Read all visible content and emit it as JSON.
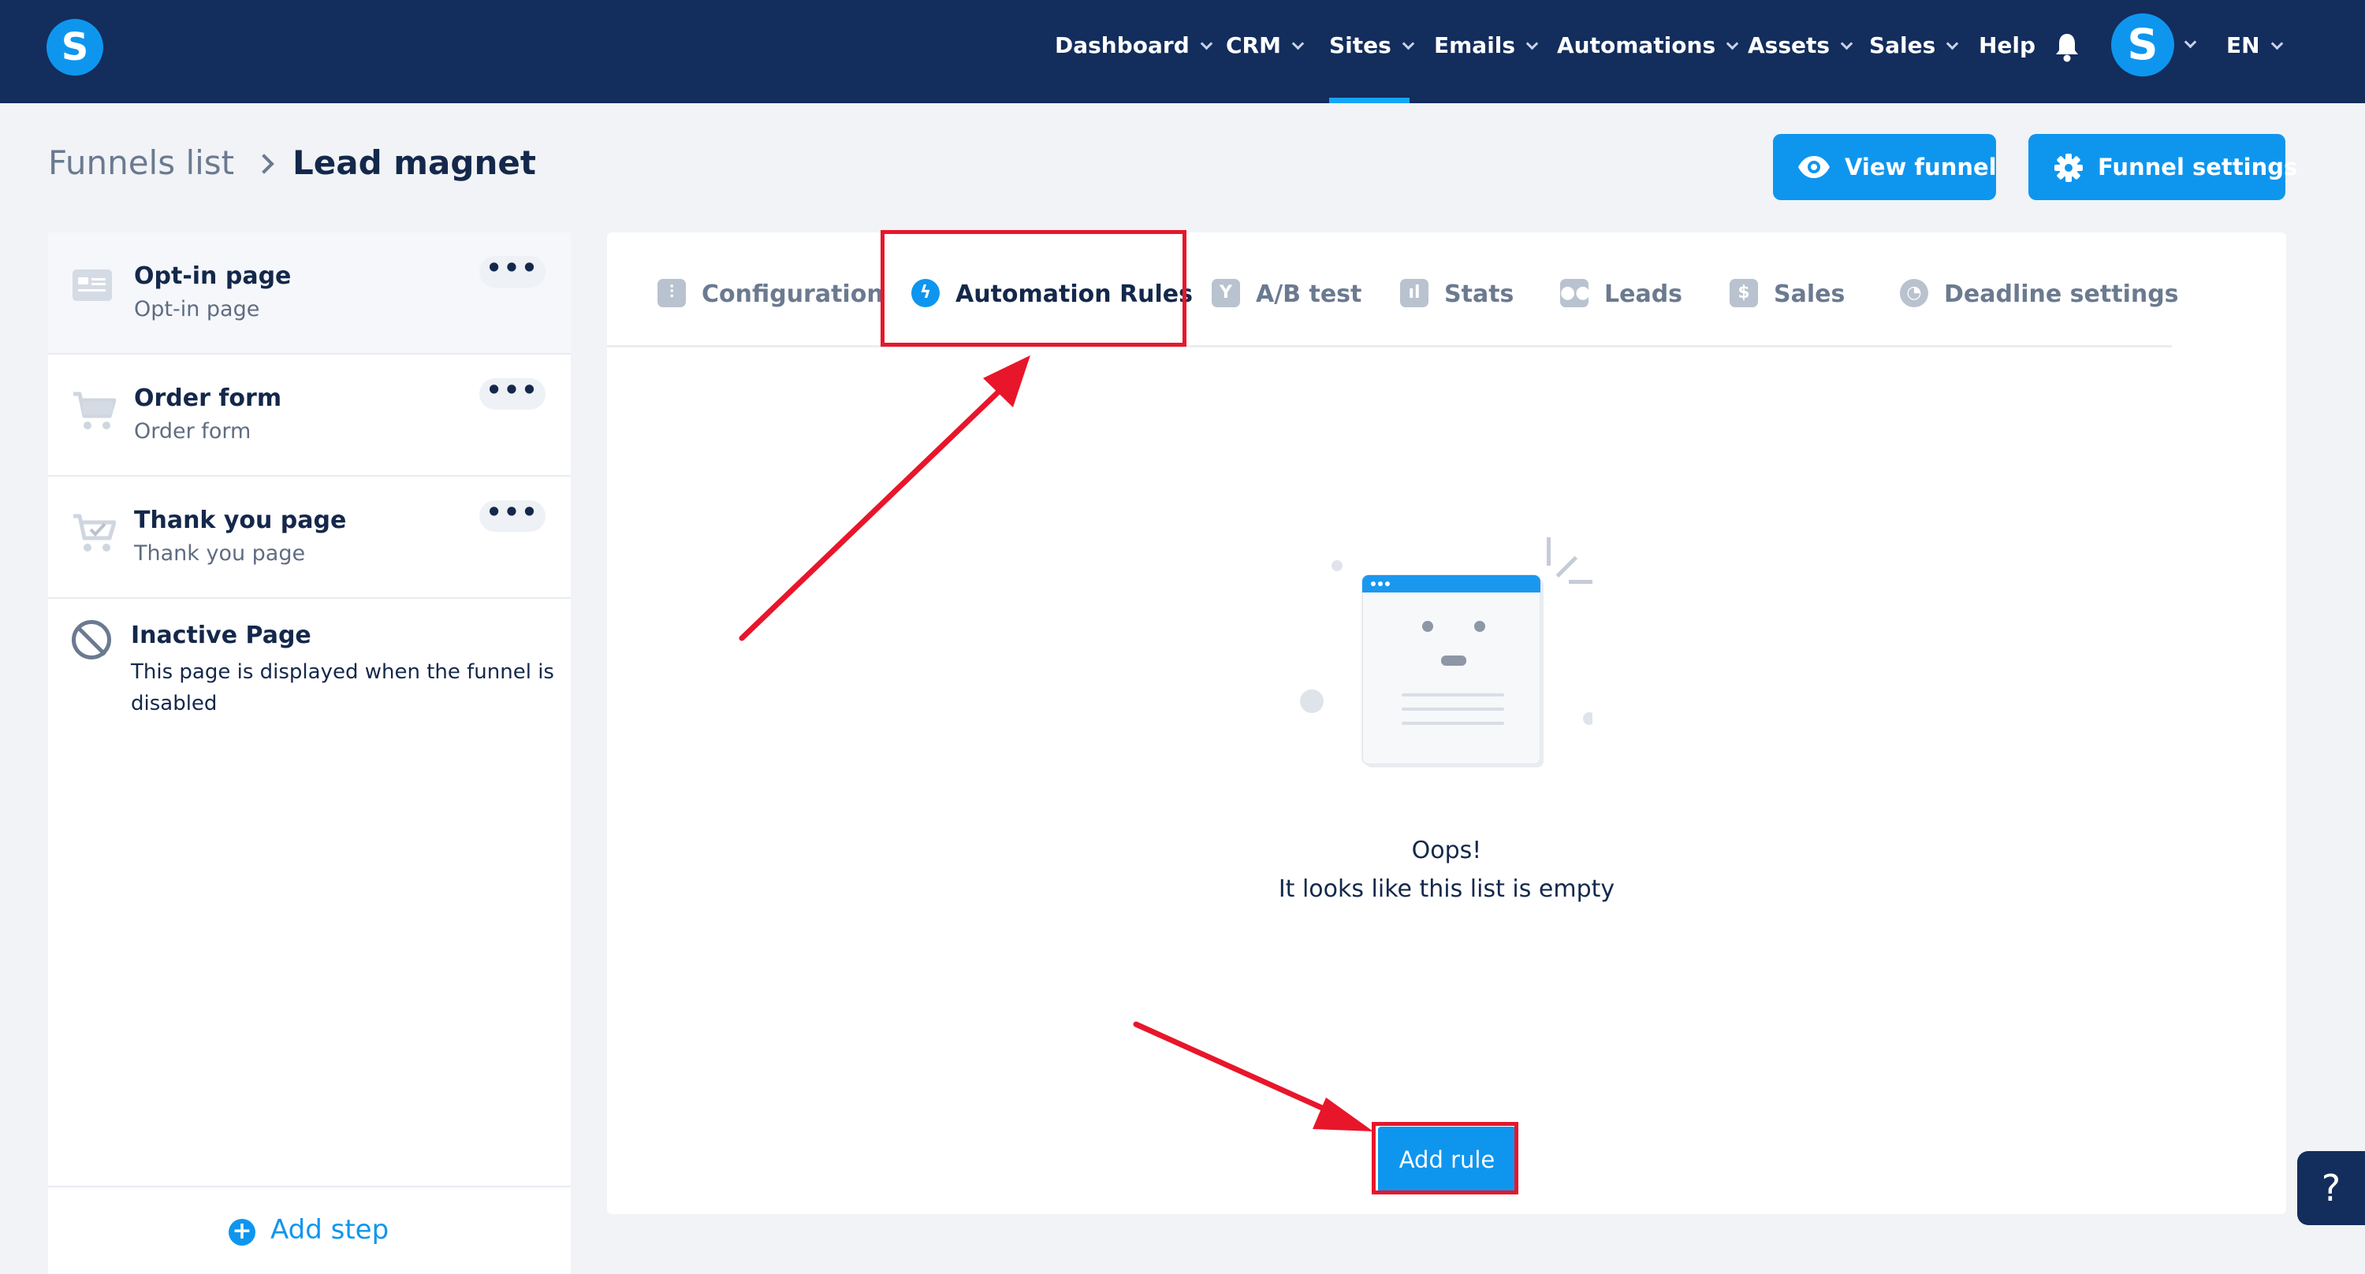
{
  "nav": {
    "items": [
      {
        "label": "Dashboard"
      },
      {
        "label": "CRM"
      },
      {
        "label": "Sites"
      },
      {
        "label": "Emails"
      },
      {
        "label": "Automations"
      },
      {
        "label": "Assets"
      },
      {
        "label": "Sales"
      },
      {
        "label": "Help"
      }
    ],
    "active": "Sites",
    "logo_letter": "S",
    "avatar_letter": "S",
    "language": "EN"
  },
  "breadcrumb": {
    "parent": "Funnels list",
    "current": "Lead magnet"
  },
  "header_buttons": {
    "view_funnel": "View funnel",
    "funnel_settings": "Funnel settings"
  },
  "steps": [
    {
      "title": "Opt-in page",
      "subtitle": "Opt-in page",
      "icon": "page-icon"
    },
    {
      "title": "Order form",
      "subtitle": "Order form",
      "icon": "cart-icon"
    },
    {
      "title": "Thank you page",
      "subtitle": "Thank you page",
      "icon": "cart-check-icon"
    }
  ],
  "more_label": "•••",
  "inactive": {
    "title": "Inactive Page",
    "description": "This page is displayed when the funnel is disabled"
  },
  "add_step": "Add step",
  "tabs": [
    {
      "label": "Configuration",
      "icon": "sliders-icon"
    },
    {
      "label": "Automation Rules",
      "icon": "lightning-icon"
    },
    {
      "label": "A/B test",
      "icon": "split-icon"
    },
    {
      "label": "Stats",
      "icon": "chart-icon"
    },
    {
      "label": "Leads",
      "icon": "users-icon"
    },
    {
      "label": "Sales",
      "icon": "dollar-icon"
    },
    {
      "label": "Deadline settings",
      "icon": "clock-icon"
    }
  ],
  "active_tab": "Automation Rules",
  "empty": {
    "line1": "Oops!",
    "line2": "It looks like this list is empty"
  },
  "add_rule": "Add rule",
  "help": "?",
  "colors": {
    "navbar": "#132d5c",
    "accent": "#0e96ef",
    "annotation": "#e8162b"
  }
}
